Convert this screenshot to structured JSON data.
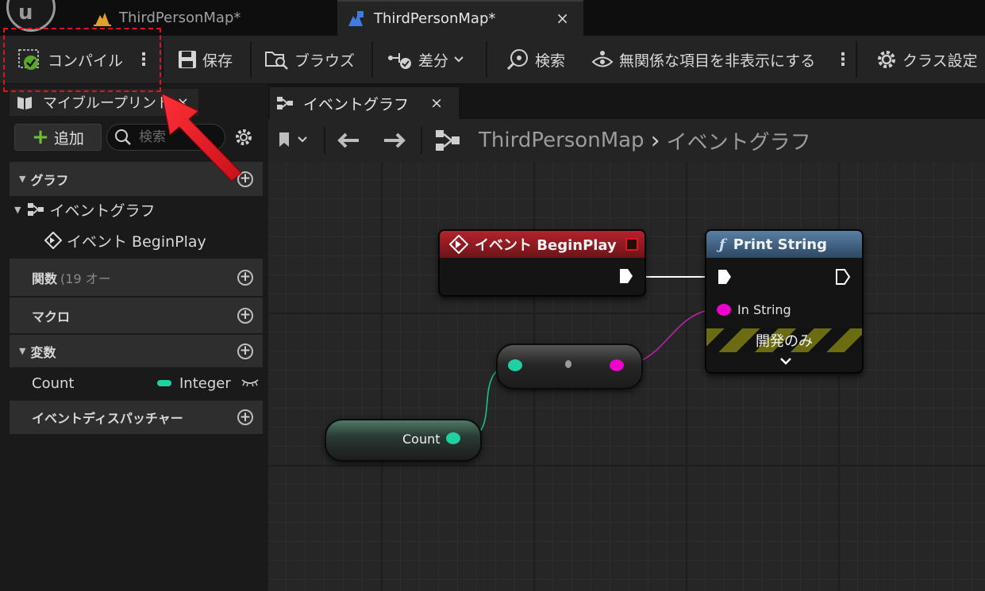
{
  "logo": {
    "glyph": "u"
  },
  "tabs": [
    {
      "label": "ThirdPersonMap*",
      "icon": "level-icon",
      "color": "#e1a12b"
    },
    {
      "label": "ThirdPersonMap*",
      "icon": "blueprint-level-icon",
      "color": "#3f7be3",
      "close": "×"
    }
  ],
  "toolbar": {
    "compile": "コンパイル",
    "save": "保存",
    "browse": "ブラウズ",
    "diff": "差分",
    "find": "検索",
    "hide_unrelated": "無関係な項目を非表示にする",
    "class_settings": "クラス設定",
    "more": "⋮"
  },
  "my_blueprint": {
    "tab_label": "マイブループリント",
    "close": "×",
    "add_label": "追加",
    "search_placeholder": "検索",
    "sections": {
      "graphs": "グラフ",
      "event_graph": "イベントグラフ",
      "begin_play": "イベント BeginPlay",
      "functions": "関数",
      "functions_count": "(19 オー",
      "macros": "マクロ",
      "variables": "変数",
      "dispatchers": "イベントディスパッチャー"
    },
    "variable": {
      "name": "Count",
      "type": "Integer",
      "type_color": "#1fd1a0"
    }
  },
  "graph": {
    "tab_label": "イベントグラフ",
    "close": "×",
    "breadcrumb": {
      "root": "ThirdPersonMap",
      "separator": "›",
      "current": "イベントグラフ"
    },
    "nodes": {
      "begin_play": "イベント BeginPlay",
      "print_string": "Print String",
      "print_func_glyph": "ƒ",
      "in_string": "In String",
      "dev_only": "開発のみ",
      "count_getter": "Count"
    },
    "colors": {
      "event": "#b5222c",
      "function": "#5a7fa3",
      "integer": "#1fd1a0",
      "string": "#ee00cc"
    }
  },
  "annotation": {
    "arrow_color": "#e0141e"
  }
}
